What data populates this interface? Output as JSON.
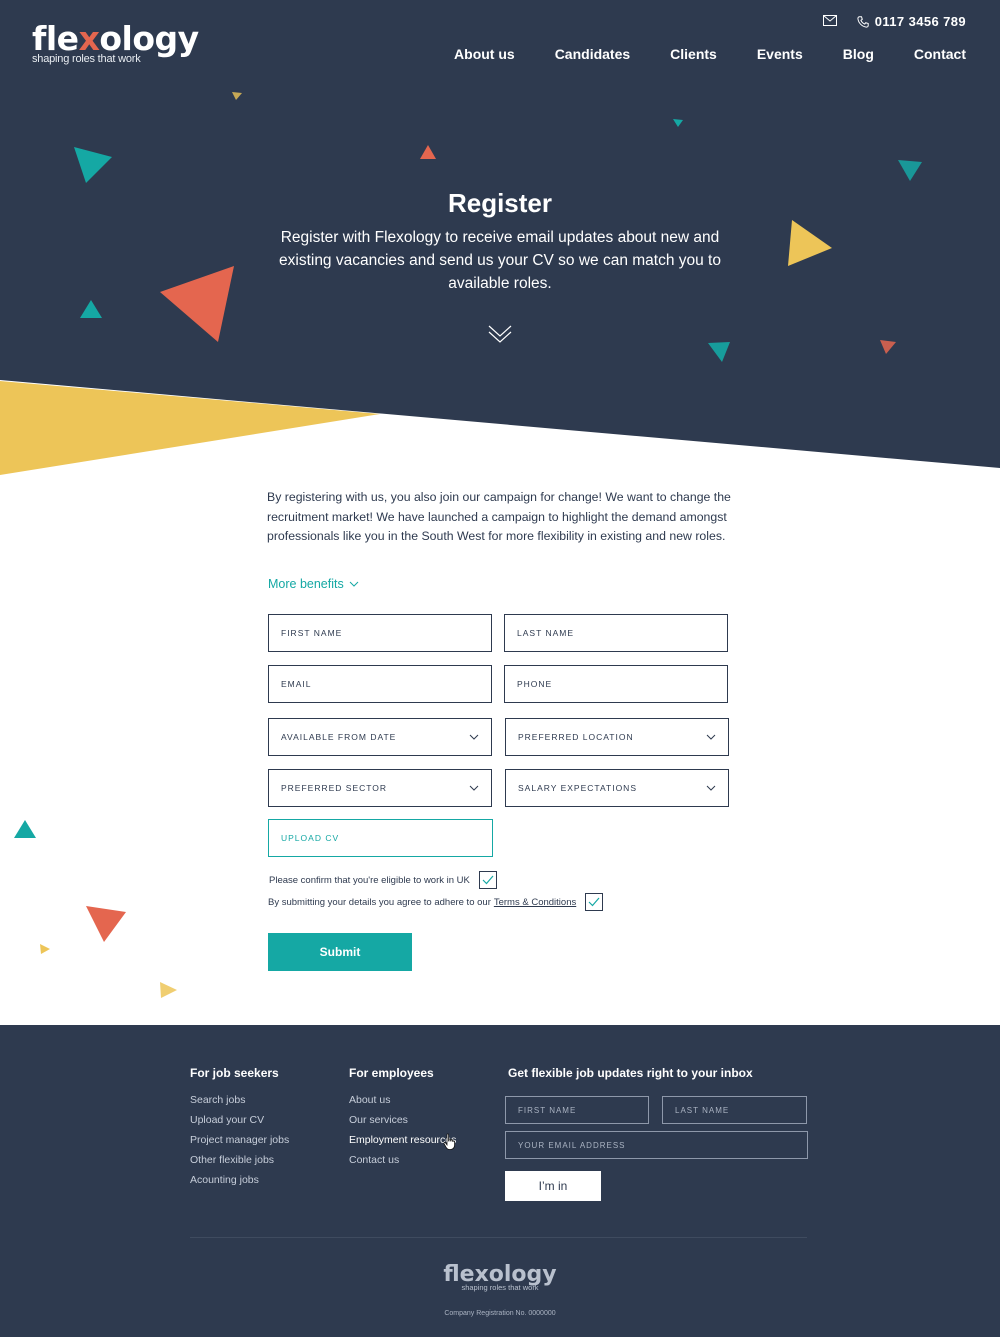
{
  "brand": {
    "logo_prefix": "fle",
    "logo_x": "x",
    "logo_suffix": "ology",
    "tagline": "shaping roles that work"
  },
  "header": {
    "mail_icon": "envelope-icon",
    "phone_icon": "phone-icon",
    "phone": "0117 3456 789"
  },
  "nav": {
    "items": [
      "About us",
      "Candidates",
      "Clients",
      "Events",
      "Blog",
      "Contact"
    ]
  },
  "hero": {
    "title": "Register",
    "subtitle": "Register with Flexology to receive email updates about new and existing vacancies and send us your CV so we can match you to available roles.",
    "scroll_icon": "chevron-down-icon"
  },
  "intro": {
    "text": "By registering with us, you also join our campaign for change! We want to change the recruitment market! We have launched a campaign to highlight the demand amongst professionals like you in the South West for more flexibility in existing and new roles.",
    "more_link": "More benefits"
  },
  "form": {
    "first_name": "FIRST NAME",
    "last_name": "LAST NAME",
    "email": "EMAIL",
    "phone": "PHONE",
    "available_from": "AVAILABLE FROM DATE",
    "preferred_location": "PREFERRED LOCATION",
    "preferred_sector": "PREFERRED SECTOR",
    "salary": "SALARY EXPECTATIONS",
    "upload_cv": "UPLOAD CV",
    "eligible_text": "Please confirm that you're eligible to work in UK",
    "terms_text": "By submitting your details you agree to adhere to our",
    "terms_link": "Terms & Conditions",
    "eligible_checked": true,
    "terms_checked": true,
    "submit": "Submit"
  },
  "footer": {
    "col1_title": "For job seekers",
    "col1_links": [
      "Search jobs",
      "Upload your CV",
      "Project manager jobs",
      "Other flexible jobs",
      "Acounting jobs"
    ],
    "col2_title": "For employees",
    "col2_links": [
      "About us",
      "Our services",
      "Employment resources",
      "Contact us"
    ],
    "newsletter_title": "Get flexible job updates right to your inbox",
    "nl_first": "FIRST NAME",
    "nl_last": "LAST NAME",
    "nl_email": "YOUR EMAIL ADDRESS",
    "nl_button": "I’m in",
    "logo_prefix": "fle",
    "logo_x": "x",
    "logo_suffix": "ology",
    "tagline": "shaping roles that work",
    "registration": "Company Registration No. 0000000"
  },
  "colors": {
    "navy": "#2e3a4f",
    "teal": "#15a8a4",
    "coral": "#e4664f",
    "yellow": "#edc558",
    "white": "#ffffff"
  }
}
